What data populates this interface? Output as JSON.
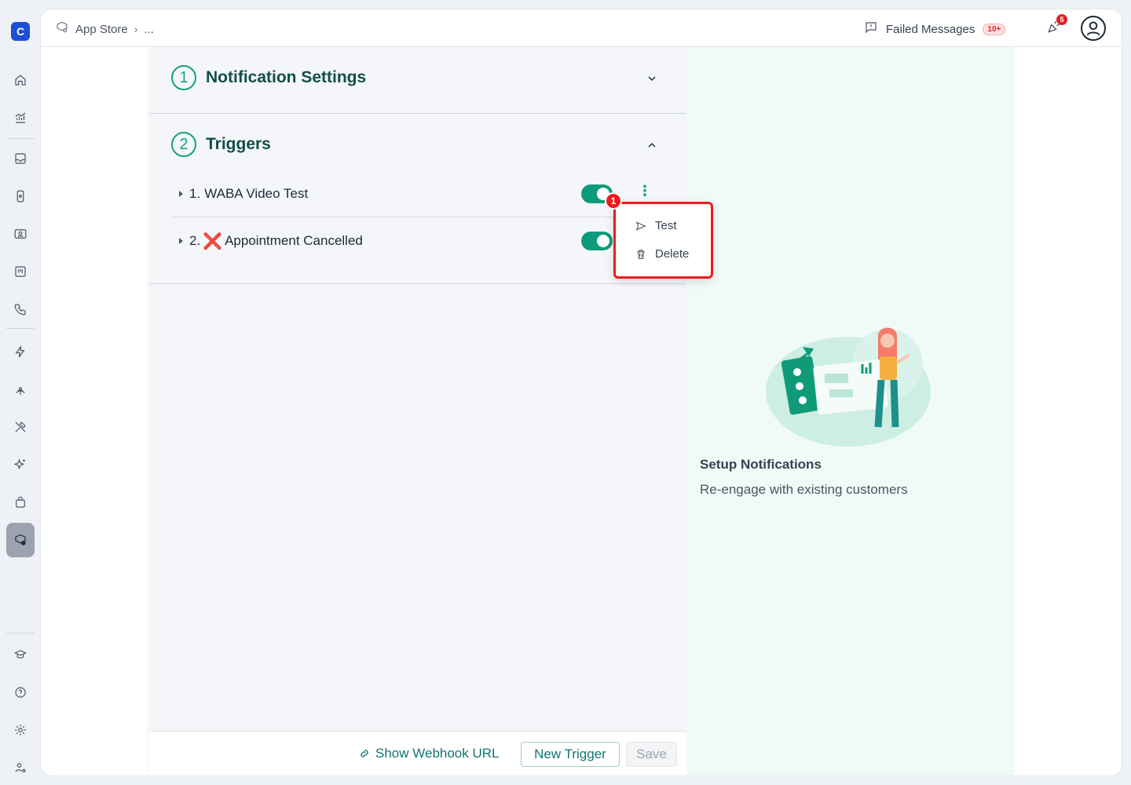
{
  "app": {
    "logo_letter": "C"
  },
  "sidebar": {
    "items": [
      {
        "name": "home-icon"
      },
      {
        "name": "analytics-icon"
      },
      {
        "name": "inbox-icon"
      },
      {
        "name": "phone-device-icon"
      },
      {
        "name": "contacts-icon"
      },
      {
        "name": "board-icon"
      },
      {
        "name": "call-icon"
      },
      {
        "name": "automation-icon"
      },
      {
        "name": "broadcast-icon"
      },
      {
        "name": "tools-icon"
      },
      {
        "name": "sparkles-icon"
      },
      {
        "name": "bag-icon"
      },
      {
        "name": "app-store-icon",
        "active": true
      }
    ],
    "bottom": [
      {
        "name": "learn-icon"
      },
      {
        "name": "help-icon"
      },
      {
        "name": "settings-icon"
      },
      {
        "name": "user-settings-icon"
      }
    ]
  },
  "header": {
    "breadcrumb_root": "App Store",
    "breadcrumb_more": "...",
    "failed_label": "Failed Messages",
    "failed_count": "10+",
    "notification_count": "5"
  },
  "sections": {
    "notification": {
      "number": "1",
      "title": "Notification Settings"
    },
    "triggers": {
      "number": "2",
      "title": "Triggers",
      "items": [
        {
          "prefix": "1.",
          "label": "WABA Video Test",
          "enabled": true
        },
        {
          "prefix": "2.",
          "emoji": "❌",
          "label": "Appointment Cancelled",
          "enabled": true
        }
      ]
    }
  },
  "menu": {
    "step": "1",
    "test": "Test",
    "delete": "Delete"
  },
  "footer": {
    "webhook": "Show Webhook URL",
    "new_trigger": "New Trigger",
    "save": "Save"
  },
  "empty_state": {
    "title": "Setup Notifications",
    "subtitle": "Re-engage with existing customers"
  },
  "colors": {
    "accent": "#0f9b7a",
    "highlight": "#ef1a1a"
  }
}
